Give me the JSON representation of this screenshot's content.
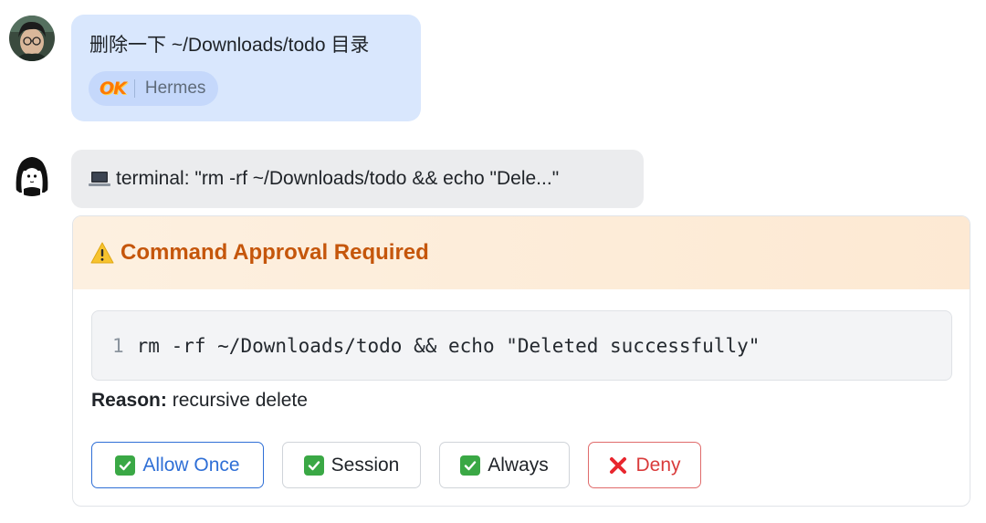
{
  "user_message": {
    "text": "删除一下 ~/Downloads/todo 目录",
    "reaction": {
      "emoji_text": "OK",
      "name": "Hermes"
    }
  },
  "tool_call": {
    "icon": "laptop-icon",
    "text": "terminal: \"rm -rf ~/Downloads/todo && echo \"Dele...\""
  },
  "approval": {
    "icon": "warning-icon",
    "title": "Command Approval Required",
    "code": {
      "line_number": "1",
      "command": "rm -rf ~/Downloads/todo && echo \"Deleted successfully\""
    },
    "reason_label": "Reason:",
    "reason_value": "recursive delete",
    "buttons": {
      "allow_once": "Allow Once",
      "session": "Session",
      "always": "Always",
      "deny": "Deny"
    }
  },
  "colors": {
    "user_bubble": "#d9e7fd",
    "tool_bubble": "#ebecee",
    "approval_title": "#c5560b",
    "allow_once": "#2f6fd6",
    "deny": "#d93b3b",
    "check": "#3aa845"
  }
}
